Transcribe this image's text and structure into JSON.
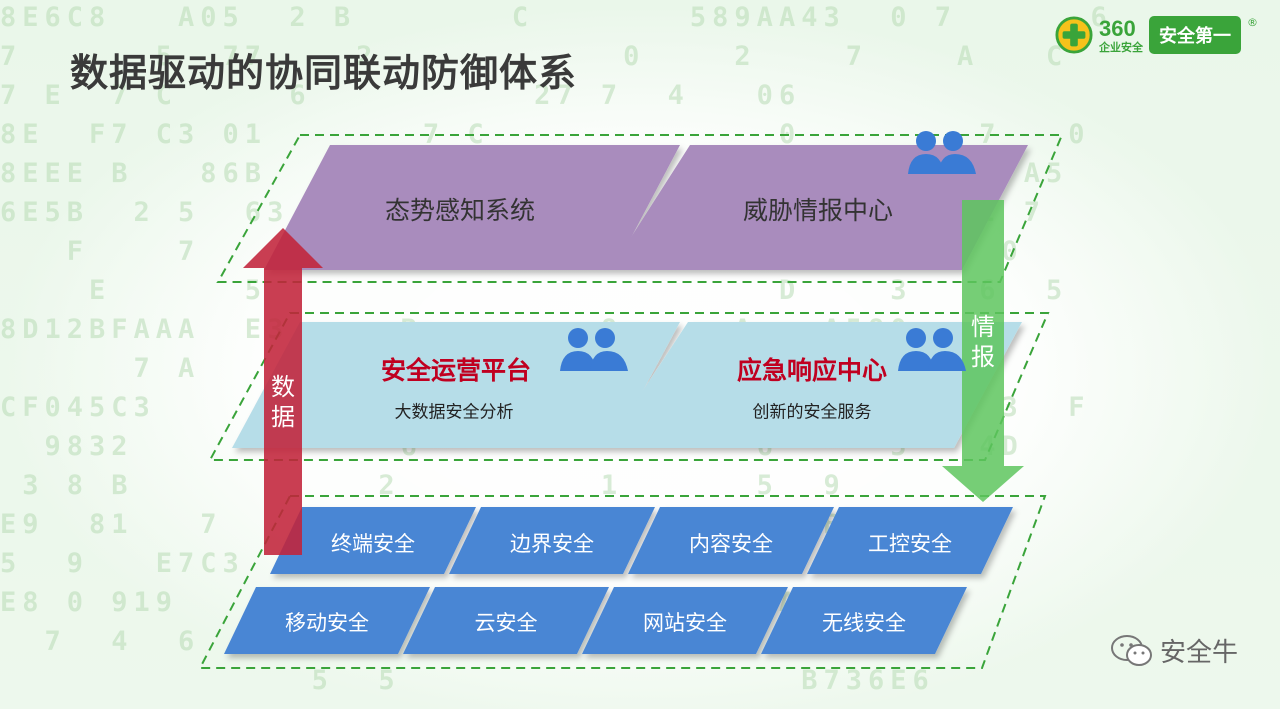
{
  "title": "数据驱动的协同联动防御体系",
  "logo": {
    "brand": "360",
    "sub": "企业安全",
    "badge": "安全第一",
    "reg": "®",
    "icon": "plus-circle-icon"
  },
  "layers": {
    "top": [
      "态势感知系统",
      "威胁情报中心"
    ],
    "middle": [
      {
        "title": "安全运营平台",
        "subtitle": "大数据安全分析"
      },
      {
        "title": "应急响应中心",
        "subtitle": "创新的安全服务"
      }
    ],
    "bottom": {
      "row1": [
        "终端安全",
        "边界安全",
        "内容安全",
        "工控安全"
      ],
      "row2": [
        "移动安全",
        "云安全",
        "网站安全",
        "无线安全"
      ]
    }
  },
  "arrows": {
    "up_label": [
      "数",
      "据"
    ],
    "down_label": [
      "情",
      "报"
    ]
  },
  "watermark": "安全牛",
  "background_hex": [
    "8E6C8   A05  2 B       C       589AA43  0 7      6",
    "7      5  77    2           0    2    7    A   C",
    "7 E  7 C     6          27 7  4   06",
    "8E  F7 C3 01       7 C             0        7   0",
    "8EEE B   86B        46B        8D4   4  C  2  A5",
    "6E5B  2 5  63           1     69D   0 0FC6  2 7",
    "   F    7            3B8  D     C4   9 C  1  0",
    "    E      5                       D    3   6  5",
    "8D12BFAAA  E3     B        8     A   A580",
    "      7 A      6 2                  5  9    8",
    "CF045C3                           1          3  F",
    "  9832            6               6     5   4D",
    " 3 8 B           2         1      5  9",
    "E9  81   7              4         8  B  3  A2",
    "5  9   E7C3  D            7      5   C    9",
    "E8 0 919          1    0     7     A   6",
    "  7  4  6              2        C     5",
    "              5  5                  B736E6"
  ],
  "colors": {
    "top_fill": "#a98cbd",
    "mid_fill": "#b6dde8",
    "bot_fill": "#4a86d4",
    "up_arrow": "#c2233a",
    "down_arrow": "#5ec55e",
    "people_icon": "#3a7bd5",
    "frame": "#3aa43a"
  },
  "icons": [
    "people-group-icon",
    "wechat-icon"
  ]
}
